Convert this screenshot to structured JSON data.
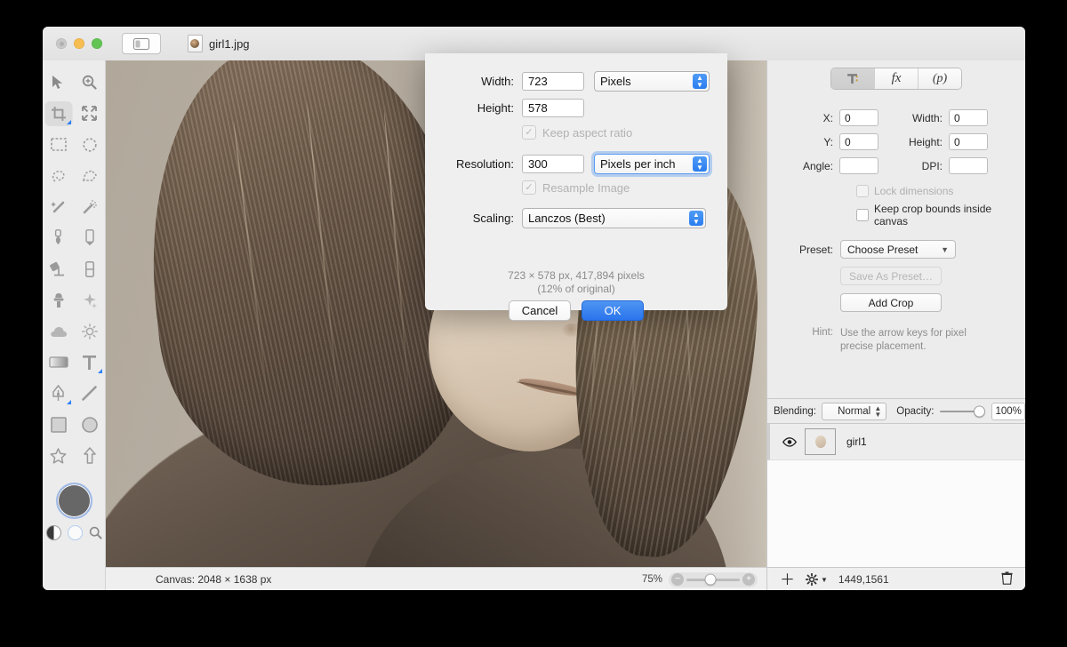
{
  "window": {
    "document_title": "girl1.jpg",
    "traffic_lights": [
      "close",
      "minimize",
      "maximize"
    ],
    "sidebar_toggle_icon": "sidebar-toggle-icon"
  },
  "tools": [
    {
      "name": "move-tool",
      "icon": "arrow-cursor-icon",
      "active": false
    },
    {
      "name": "zoom-tool",
      "icon": "magnifier-plus-icon",
      "active": false
    },
    {
      "name": "crop-tool",
      "icon": "crop-icon",
      "active": true
    },
    {
      "name": "transform-tool",
      "icon": "move-arrows-icon",
      "active": false
    },
    {
      "name": "rectangle-select-tool",
      "icon": "marquee-rect-icon",
      "active": false
    },
    {
      "name": "ellipse-select-tool",
      "icon": "marquee-ellipse-icon",
      "active": false
    },
    {
      "name": "lasso-tool",
      "icon": "lasso-icon",
      "active": false
    },
    {
      "name": "polygon-lasso-tool",
      "icon": "polygon-lasso-icon",
      "active": false
    },
    {
      "name": "magic-wand-tool",
      "icon": "magic-wand-icon",
      "active": false
    },
    {
      "name": "smart-select-tool",
      "icon": "sparkle-wand-icon",
      "active": false
    },
    {
      "name": "brush-tool",
      "icon": "brush-icon",
      "active": false
    },
    {
      "name": "pencil-tool",
      "icon": "pencil-icon",
      "active": false
    },
    {
      "name": "paint-bucket-tool",
      "icon": "paint-bucket-icon",
      "active": false
    },
    {
      "name": "eraser-tool",
      "icon": "eraser-icon",
      "active": false
    },
    {
      "name": "clone-stamp-tool",
      "icon": "clone-stamp-icon",
      "active": false
    },
    {
      "name": "healing-tool",
      "icon": "healing-sparkle-icon",
      "active": false
    },
    {
      "name": "blur-tool",
      "icon": "cloud-icon",
      "active": false
    },
    {
      "name": "dodge-tool",
      "icon": "sun-icon",
      "active": false
    },
    {
      "name": "gradient-tool",
      "icon": "gradient-icon",
      "active": false
    },
    {
      "name": "text-tool",
      "icon": "text-t-icon",
      "active": false
    },
    {
      "name": "pen-tool",
      "icon": "pen-nib-icon",
      "active": false
    },
    {
      "name": "line-tool",
      "icon": "line-icon",
      "active": false
    },
    {
      "name": "rectangle-shape-tool",
      "icon": "square-icon",
      "active": false
    },
    {
      "name": "ellipse-shape-tool",
      "icon": "circle-icon",
      "active": false
    },
    {
      "name": "star-shape-tool",
      "icon": "star-icon",
      "active": false
    },
    {
      "name": "arrow-shape-tool",
      "icon": "arrow-up-icon",
      "active": false
    }
  ],
  "color_swatch": {
    "foreground_color": "#676767",
    "half_circle_icon": "contrast-circle-icon",
    "ring_icon": "color-ring-icon",
    "loupe_icon": "magnifier-icon"
  },
  "statusbar": {
    "canvas_label": "Canvas: 2048 × 1638 px",
    "zoom_percent": "75%",
    "zoom_out_icon": "zoom-out-icon",
    "zoom_in_icon": "zoom-in-icon"
  },
  "right_panel": {
    "tabs": [
      {
        "label": "",
        "icon": "tool-options-icon",
        "active": true
      },
      {
        "label": "fx",
        "icon": "effects-icon",
        "active": false
      },
      {
        "label": "(p)",
        "icon": "parameters-icon",
        "active": false
      }
    ],
    "fields": {
      "x_label": "X:",
      "x_value": "0",
      "width_label": "Width:",
      "width_value": "0",
      "y_label": "Y:",
      "y_value": "0",
      "height_label": "Height:",
      "height_value": "0",
      "angle_label": "Angle:",
      "angle_value": "",
      "dpi_label": "DPI:",
      "dpi_value": ""
    },
    "checkboxes": [
      {
        "label": "Lock dimensions",
        "checked": false,
        "enabled": false
      },
      {
        "label": "Keep crop bounds inside canvas",
        "checked": false,
        "enabled": true
      }
    ],
    "preset_label": "Preset:",
    "preset_value": "Choose Preset",
    "save_preset_label": "Save As Preset…",
    "add_crop_label": "Add Crop",
    "hint_label": "Hint:",
    "hint_text": "Use the arrow keys for pixel precise placement."
  },
  "layers": {
    "blending_label": "Blending:",
    "blending_value": "Normal",
    "opacity_label": "Opacity:",
    "opacity_value": "100%",
    "items": [
      {
        "name": "girl1",
        "visible": true
      }
    ],
    "footer": {
      "add_icon": "plus-icon",
      "settings_icon": "gear-icon",
      "coordinates": "1449,1561",
      "delete_icon": "trash-icon"
    }
  },
  "dialog": {
    "width_label": "Width:",
    "width_value": "723",
    "width_unit": "Pixels",
    "height_label": "Height:",
    "height_value": "578",
    "keep_aspect_label": "Keep aspect ratio",
    "keep_aspect_checked": true,
    "resolution_label": "Resolution:",
    "resolution_value": "300",
    "resolution_unit": "Pixels per inch",
    "resample_label": "Resample Image",
    "resample_checked": true,
    "scaling_label": "Scaling:",
    "scaling_value": "Lanczos (Best)",
    "summary_line1": "723 × 578 px, 417,894 pixels",
    "summary_line2": "(12% of original)",
    "cancel_label": "Cancel",
    "ok_label": "OK",
    "accent_color": "#2a74ec"
  }
}
